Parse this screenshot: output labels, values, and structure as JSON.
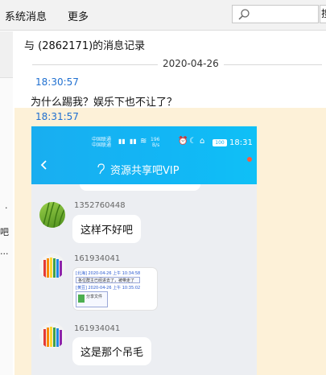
{
  "menu": {
    "system_messages": "系统消息",
    "more": "更多"
  },
  "search": {
    "placeholder": "",
    "button_label": "搜"
  },
  "gutter": {
    "texts": [
      "·",
      "吧",
      "..."
    ]
  },
  "record": {
    "title": "与   (2862171)的消息记录",
    "date": "2020-04-26"
  },
  "messages": [
    {
      "time": "18:30:57",
      "text": "为什么踢我？娱乐下也不让了？"
    },
    {
      "time": "18:31:57",
      "text": ""
    }
  ],
  "phone": {
    "carrier_top": "中国联通",
    "carrier_bottom": "中国联通",
    "net_speed_top": "196",
    "net_speed_bottom": "B/s",
    "battery": "100",
    "time": "18:31",
    "chat_title": "资源共享吧VIP",
    "colors": {
      "header": "#12b6f5",
      "accent_dot": "#ff5a3c"
    }
  },
  "chat": [
    {
      "sender": "1352760448",
      "text": "这样不好吧"
    },
    {
      "sender": "161934041",
      "image_lines": [
        "[北海]   2020-04-26 上午 10:34:58",
        "各位群主已经进去了，被带走了",
        "[黄豆]   2020-04-26 上午 10:35:02",
        "分享文件"
      ]
    },
    {
      "sender": "161934041",
      "text": "这是那个吊毛"
    }
  ]
}
